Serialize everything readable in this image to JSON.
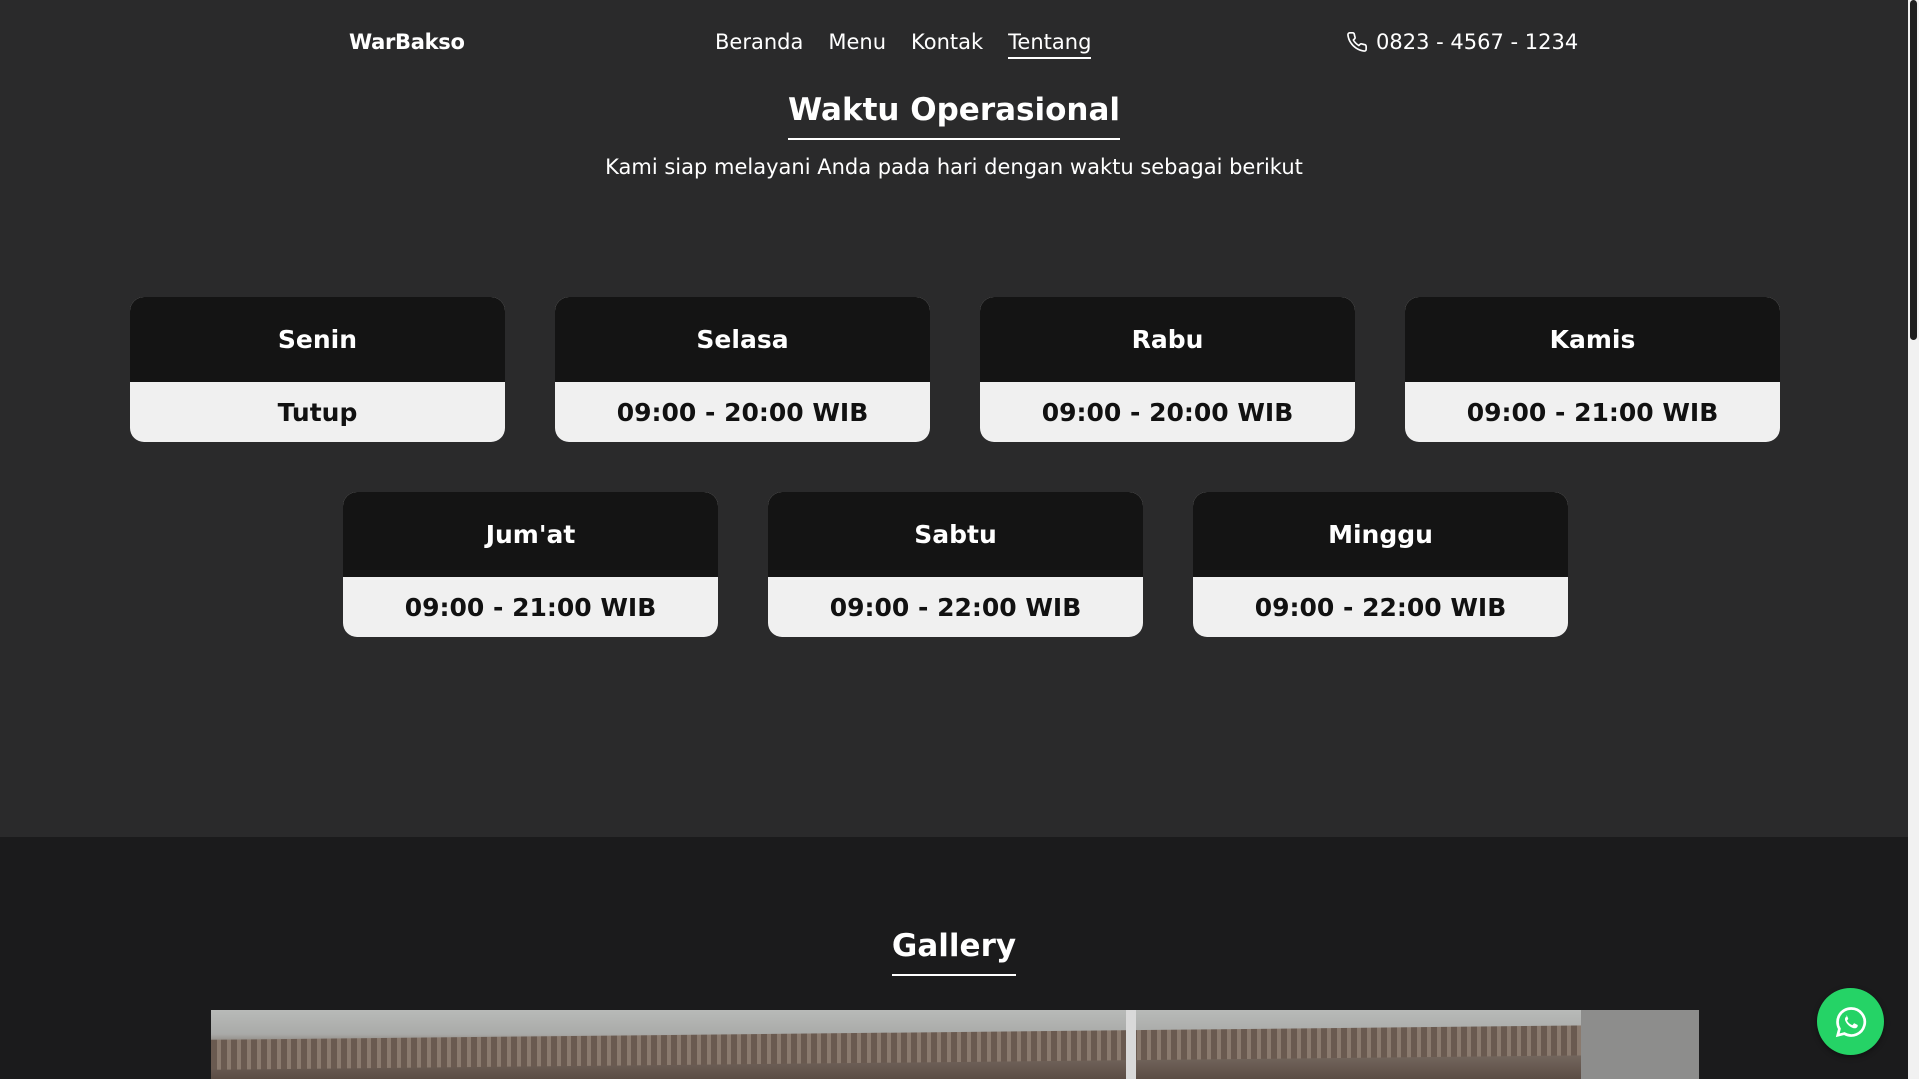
{
  "header": {
    "brand": "WarBakso",
    "nav": [
      "Beranda",
      "Menu",
      "Kontak",
      "Tentang"
    ],
    "active_nav": "Tentang",
    "phone": "0823 - 4567 - 1234"
  },
  "operational": {
    "title": "Waktu Operasional",
    "subtitle": "Kami siap melayani Anda pada hari dengan waktu sebagai berikut",
    "days": [
      {
        "day": "Senin",
        "hours": "Tutup"
      },
      {
        "day": "Selasa",
        "hours": "09:00 - 20:00 WIB"
      },
      {
        "day": "Rabu",
        "hours": "09:00 - 20:00 WIB"
      },
      {
        "day": "Kamis",
        "hours": "09:00 - 21:00 WIB"
      },
      {
        "day": "Jum'at",
        "hours": "09:00 - 21:00 WIB"
      },
      {
        "day": "Sabtu",
        "hours": "09:00 - 22:00 WIB"
      },
      {
        "day": "Minggu",
        "hours": "09:00 - 22:00 WIB"
      }
    ]
  },
  "gallery": {
    "title": "Gallery"
  },
  "colors": {
    "page_bg": "#2a2a2b",
    "gallery_bg": "#1b1b1c",
    "card_header": "#141414",
    "card_body": "#f0f0f0",
    "whatsapp": "#25d366"
  },
  "icons": {
    "phone": "phone-icon",
    "whatsapp": "whatsapp-icon"
  }
}
